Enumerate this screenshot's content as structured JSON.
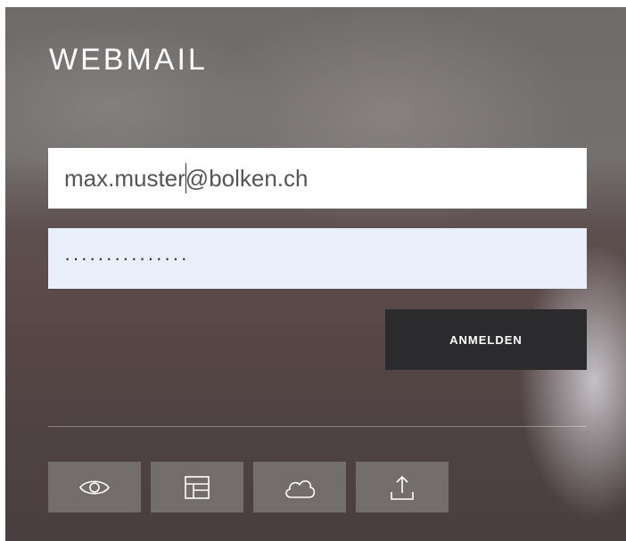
{
  "header": {
    "title": "WEBMAIL"
  },
  "form": {
    "email_value": "max.muster@bolken.ch",
    "password_masked": "···············"
  },
  "actions": {
    "login_label": "ANMELDEN"
  },
  "toolbar": {
    "icons": [
      "eye-icon",
      "layout-icon",
      "cloud-icon",
      "upload-icon"
    ]
  },
  "colors": {
    "button_bg": "#2b2b2e",
    "password_bg": "#e8effb",
    "tool_bg": "#9a9192"
  }
}
